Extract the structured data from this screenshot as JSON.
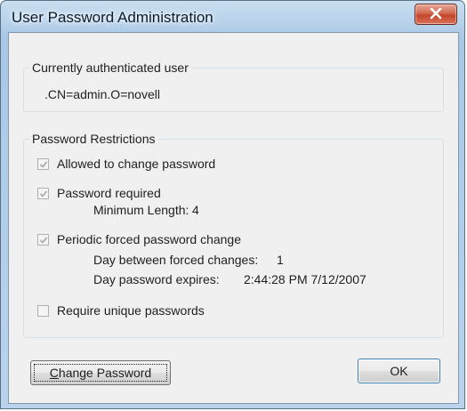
{
  "window": {
    "title": "User Password Administration"
  },
  "auth_group": {
    "title": "Currently authenticated user",
    "user": ".CN=admin.O=novell"
  },
  "restrictions": {
    "title": "Password Restrictions",
    "allow_change": {
      "label": "Allowed to change password",
      "checked": true,
      "enabled": false
    },
    "required": {
      "label": "Password required",
      "checked": true,
      "enabled": false,
      "min_length_label": "Minimum Length:",
      "min_length_value": "4"
    },
    "periodic": {
      "label": "Periodic forced password change",
      "checked": true,
      "enabled": false,
      "days_label": "Day between forced changes:",
      "days_value": "1",
      "expires_label": "Day password expires:",
      "expires_value": "2:44:28 PM 7/12/2007"
    },
    "unique": {
      "label": "Require unique passwords",
      "checked": false,
      "enabled": false
    }
  },
  "buttons": {
    "change_password_mnemonic": "C",
    "change_password_rest": "hange Password",
    "ok": "OK"
  }
}
